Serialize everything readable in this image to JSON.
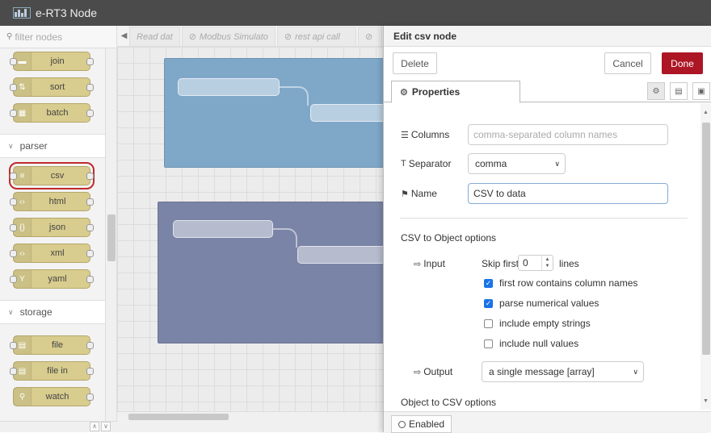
{
  "app": {
    "title": "e-RT3 Node"
  },
  "palette": {
    "filter_placeholder": "filter nodes",
    "top_nodes": [
      {
        "label": "join",
        "icon": "join-icon"
      },
      {
        "label": "sort",
        "icon": "sort-icon"
      },
      {
        "label": "batch",
        "icon": "batch-icon"
      }
    ],
    "categories": [
      {
        "name": "parser",
        "nodes": [
          "csv",
          "html",
          "json",
          "xml",
          "yaml"
        ]
      },
      {
        "name": "storage",
        "nodes": [
          "file",
          "file in",
          "watch"
        ]
      }
    ],
    "selected_node": "csv",
    "node_color": "#d8cc8e"
  },
  "workspace": {
    "tabs": [
      "Read dat",
      "Modbus Simulato",
      "rest api call",
      ""
    ]
  },
  "tray": {
    "title": "Edit csv node",
    "delete_label": "Delete",
    "cancel_label": "Cancel",
    "done_label": "Done",
    "properties_tab": "Properties",
    "columns_label": "Columns",
    "columns_placeholder": "comma-separated column names",
    "separator_label": "Separator",
    "separator_value": "comma",
    "name_label": "Name",
    "name_value": "CSV  to data",
    "csv_to_object_title": "CSV to Object options",
    "input_label": "Input",
    "skip_first_label": "Skip first",
    "skip_first_value": "0",
    "lines_label": "lines",
    "opt_first_row": "first row contains column names",
    "opt_parse_numerical": "parse numerical values",
    "opt_include_empty": "include empty strings",
    "opt_include_null": "include null values",
    "opt_states": {
      "first_row": true,
      "parse_numerical": true,
      "include_empty": false,
      "include_null": false
    },
    "output_label": "Output",
    "output_value": "a single message [array]",
    "object_to_csv_title": "Object to CSV options",
    "enabled_label": "Enabled",
    "done_color": "#ad1625"
  }
}
